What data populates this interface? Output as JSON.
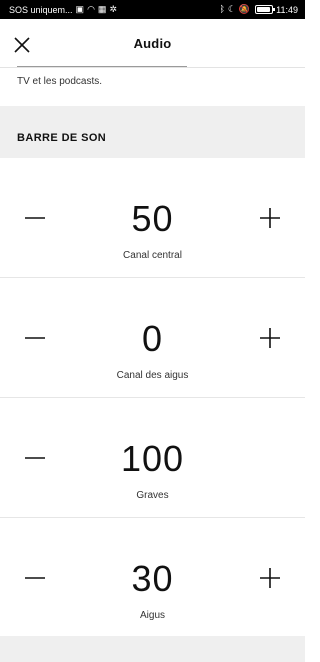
{
  "status_bar": {
    "carrier": "SOS uniquem...",
    "time": "11:49",
    "icons": [
      "notification-icon",
      "wifi-icon",
      "cast-icon",
      "bluetooth-icon",
      "dnd-moon-icon",
      "silent-icon",
      "battery-icon"
    ]
  },
  "header": {
    "title": "Audio",
    "close_icon": "close-icon"
  },
  "intro": {
    "text": "TV et les podcasts."
  },
  "section": {
    "title": "BARRE DE SON"
  },
  "controls": [
    {
      "label": "Canal central",
      "value": "50"
    },
    {
      "label": "Canal des aigus",
      "value": "0"
    },
    {
      "label": "Graves",
      "value": "100"
    },
    {
      "label": "Aigus",
      "value": "30"
    }
  ]
}
